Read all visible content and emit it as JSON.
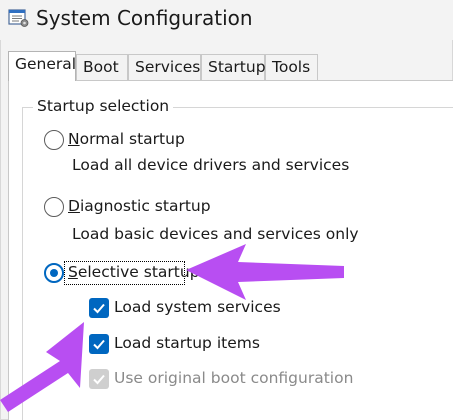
{
  "window": {
    "title": "System Configuration",
    "icon": "msconfig-app-icon"
  },
  "tabs": [
    {
      "label": "General",
      "active": true
    },
    {
      "label": "Boot",
      "active": false
    },
    {
      "label": "Services",
      "active": false
    },
    {
      "label": "Startup",
      "active": false
    },
    {
      "label": "Tools",
      "active": false
    }
  ],
  "startup_selection": {
    "group_label": "Startup selection",
    "normal": {
      "label_first": "N",
      "label_rest": "ormal startup",
      "description": "Load all device drivers and services",
      "selected": false
    },
    "diagnostic": {
      "label_first": "D",
      "label_rest": "iagnostic startup",
      "description": "Load basic devices and services only",
      "selected": false
    },
    "selective": {
      "label_first": "S",
      "label_rest": "elective startup",
      "selected": true
    },
    "options": [
      {
        "label_first": "L",
        "label_rest": "oad system services",
        "checked": true,
        "enabled": true
      },
      {
        "label_first": "L",
        "label_rest": "oad startup items",
        "checked": true,
        "enabled": true
      },
      {
        "label_first": "U",
        "label_rest": "se original boot configuration",
        "checked": true,
        "enabled": false
      }
    ]
  },
  "colors": {
    "accent": "#0067c0",
    "annotation_arrow": "#b84ef2"
  }
}
